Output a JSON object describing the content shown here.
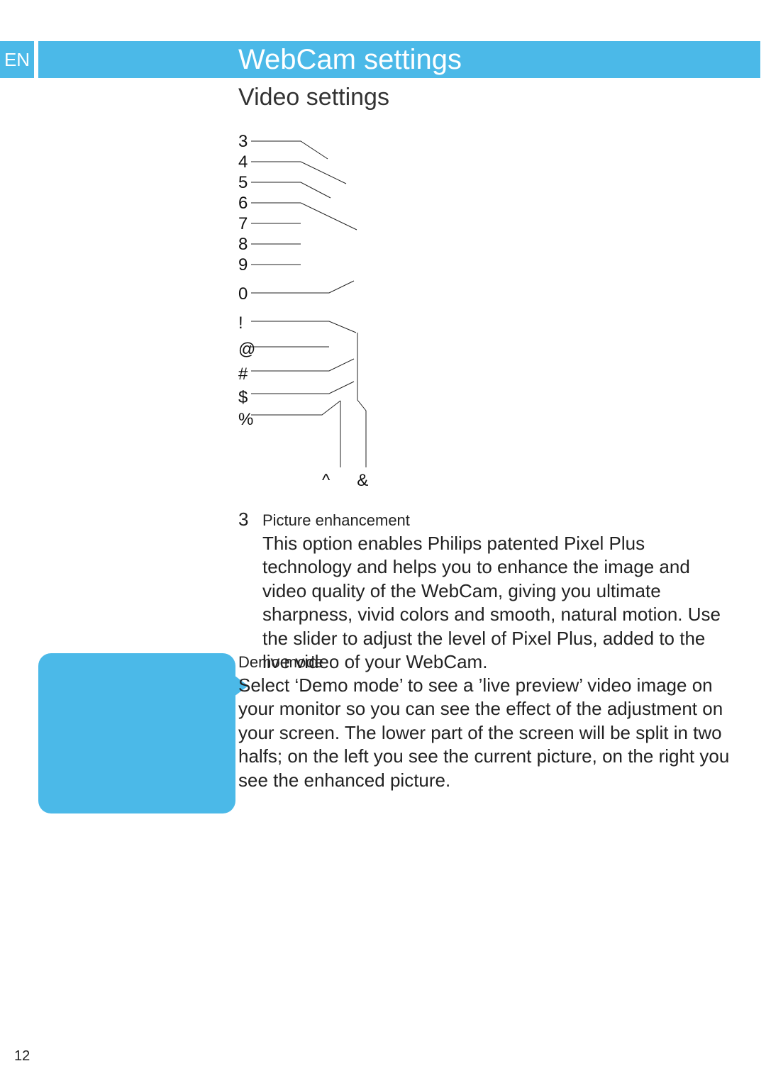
{
  "lang": "EN",
  "title": "WebCam settings",
  "section": "Video settings",
  "callouts": {
    "left_column": [
      "3",
      "4",
      "5",
      "6",
      "7",
      "8",
      "9",
      "0",
      "!",
      "@",
      "#",
      "$",
      "%"
    ],
    "bottom": {
      "caret": "^",
      "amp": "&"
    }
  },
  "items": [
    {
      "number": "3",
      "heading": "Picture enhancement",
      "body": "This option enables Philips patented Pixel Plus technology and helps you to enhance the image and video quality of the WebCam, giving you ultimate sharpness, vivid colors and smooth, natural motion. Use the slider to adjust the level of Pixel Plus, added to the live video of your WebCam."
    },
    {
      "heading": "Demo mode",
      "body": "Select ‘Demo mode’ to see a ’live preview’ video image on your monitor so you can see the effect of the adjustment on your screen. The lower part of the screen will be split in two halfs; on the left you see the current picture, on the right you see the enhanced picture."
    }
  ],
  "page_number": "12"
}
